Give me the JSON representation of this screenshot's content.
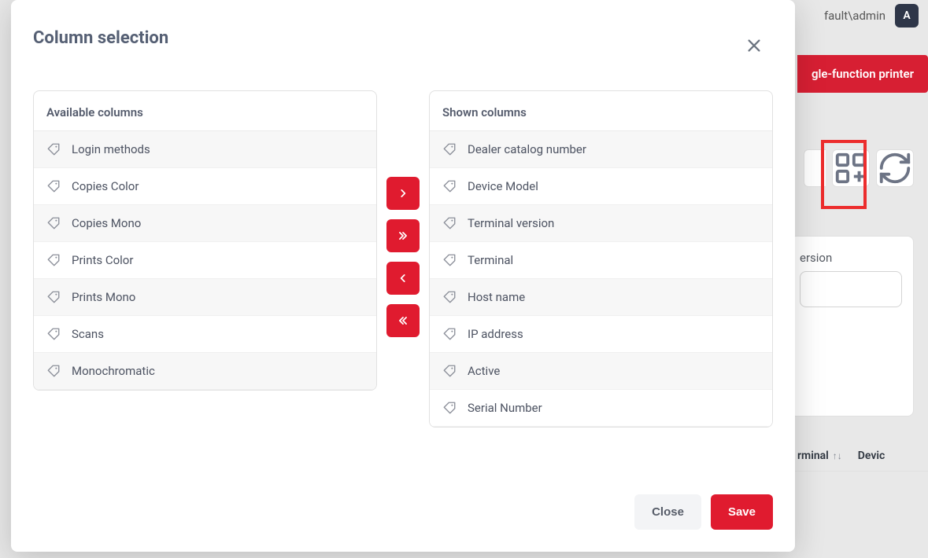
{
  "background": {
    "user_label": "fault\\admin",
    "avatar_letter": "A",
    "red_button": "gle-function printer",
    "panel_label": "ersion",
    "th1": "rminal",
    "th2": "Devic"
  },
  "modal": {
    "title": "Column selection",
    "available_header": "Available columns",
    "shown_header": "Shown columns",
    "available_items": [
      "Login methods",
      "Copies Color",
      "Copies Mono",
      "Prints Color",
      "Prints Mono",
      "Scans",
      "Monochromatic"
    ],
    "shown_items": [
      "Dealer catalog number",
      "Device Model",
      "Terminal version",
      "Terminal",
      "Host name",
      "IP address",
      "Active",
      "Serial Number"
    ],
    "close_label": "Close",
    "save_label": "Save"
  }
}
